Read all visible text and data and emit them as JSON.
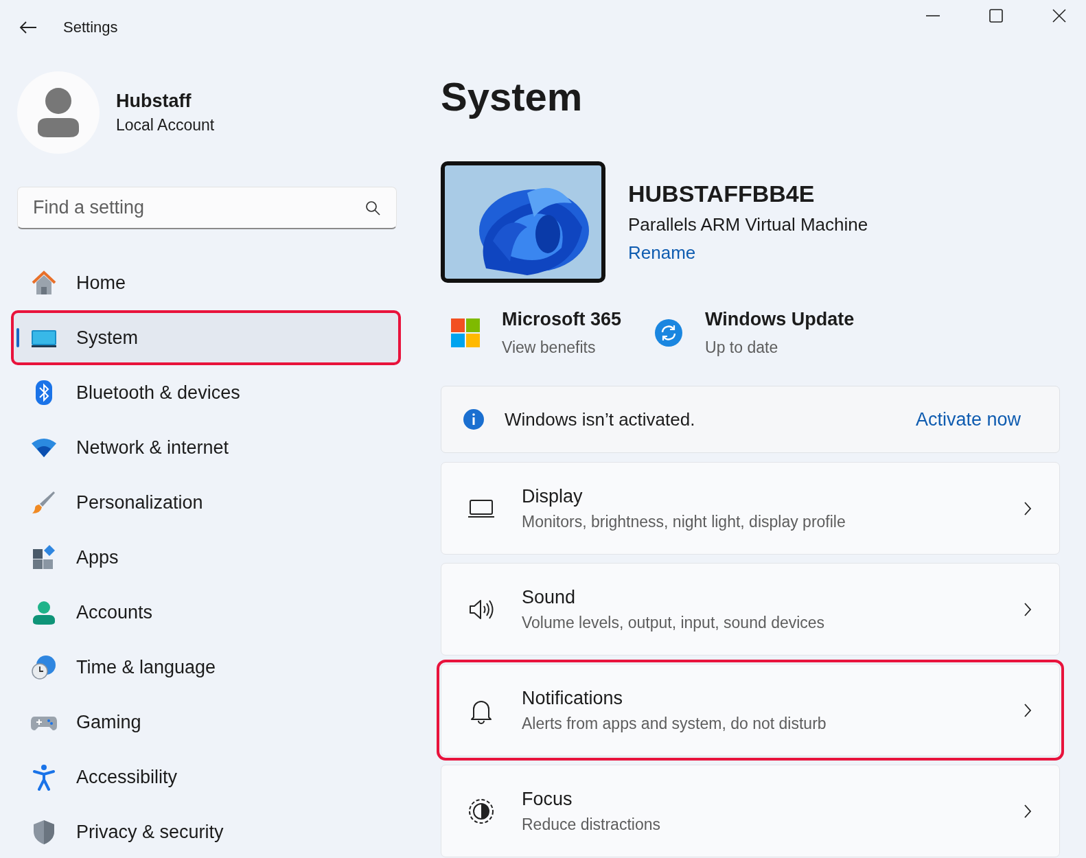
{
  "window": {
    "title": "Settings"
  },
  "account": {
    "name": "Hubstaff",
    "type": "Local Account"
  },
  "search": {
    "placeholder": "Find a setting"
  },
  "nav": [
    {
      "kind": "home",
      "label": "Home",
      "selected": false,
      "highlighted": false
    },
    {
      "kind": "system",
      "label": "System",
      "selected": true,
      "highlighted": true
    },
    {
      "kind": "bluetooth",
      "label": "Bluetooth & devices",
      "selected": false,
      "highlighted": false
    },
    {
      "kind": "network",
      "label": "Network & internet",
      "selected": false,
      "highlighted": false
    },
    {
      "kind": "personalization",
      "label": "Personalization",
      "selected": false,
      "highlighted": false
    },
    {
      "kind": "apps",
      "label": "Apps",
      "selected": false,
      "highlighted": false
    },
    {
      "kind": "accounts",
      "label": "Accounts",
      "selected": false,
      "highlighted": false
    },
    {
      "kind": "time",
      "label": "Time & language",
      "selected": false,
      "highlighted": false
    },
    {
      "kind": "gaming",
      "label": "Gaming",
      "selected": false,
      "highlighted": false
    },
    {
      "kind": "accessibility",
      "label": "Accessibility",
      "selected": false,
      "highlighted": false
    },
    {
      "kind": "privacy",
      "label": "Privacy & security",
      "selected": false,
      "highlighted": false
    }
  ],
  "page_title": "System",
  "device": {
    "name": "HUBSTAFFBB4E",
    "model": "Parallels ARM Virtual Machine",
    "rename": "Rename"
  },
  "quick_links": [
    {
      "kind": "microsoft",
      "title": "Microsoft 365",
      "subtitle": "View benefits"
    },
    {
      "kind": "update",
      "title": "Windows Update",
      "subtitle": "Up to date"
    }
  ],
  "banner": {
    "message": "Windows isn’t activated.",
    "action": "Activate now"
  },
  "cards": [
    {
      "kind": "display",
      "title": "Display",
      "subtitle": "Monitors, brightness, night light, display profile",
      "highlighted": false
    },
    {
      "kind": "sound",
      "title": "Sound",
      "subtitle": "Volume levels, output, input, sound devices",
      "highlighted": false
    },
    {
      "kind": "notifications",
      "title": "Notifications",
      "subtitle": "Alerts from apps and system, do not disturb",
      "highlighted": true
    },
    {
      "kind": "focus",
      "title": "Focus",
      "subtitle": "Reduce distractions",
      "highlighted": false
    }
  ]
}
